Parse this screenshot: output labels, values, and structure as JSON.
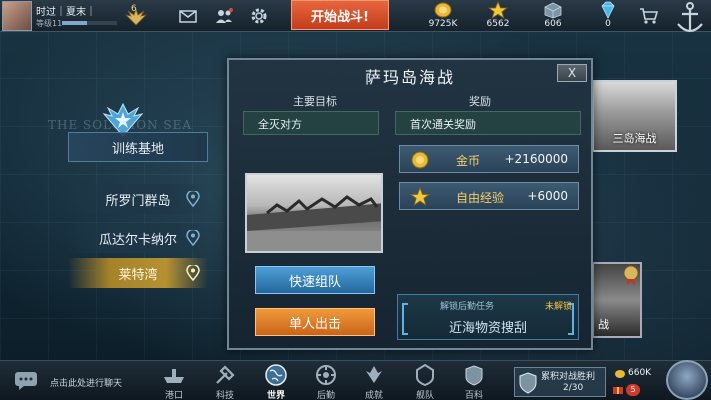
{
  "player": {
    "name": "时过｜夏末｜",
    "level_label": "等级11",
    "rank": "6",
    "xp_progress": 0.45
  },
  "top_actions": {
    "start_battle": "开始战斗!"
  },
  "resources": [
    {
      "icon": "gold-coin-icon",
      "value": "9725K"
    },
    {
      "icon": "star-exp-icon",
      "value": "6562"
    },
    {
      "icon": "supply-crate-icon",
      "value": "606"
    },
    {
      "icon": "diamond-icon",
      "value": "0"
    }
  ],
  "map": {
    "sea_label": "THE SOLOMON SEA"
  },
  "left_menu": {
    "base": "训练基地",
    "locations": [
      {
        "label": "所罗门群岛",
        "selected": false
      },
      {
        "label": "瓜达尔卡纳尔",
        "selected": false
      },
      {
        "label": "莱特湾",
        "selected": true
      }
    ]
  },
  "side_previews": {
    "preview_a_caption": "三岛海战",
    "preview_b_caption": "战"
  },
  "dialog": {
    "title": "萨玛岛海战",
    "close_label": "X",
    "objective_header": "主要目标",
    "reward_header": "奖励",
    "objective": "全灭对方",
    "first_clear_label": "首次通关奖励",
    "rewards": [
      {
        "icon": "gold-coin-icon",
        "name": "金币",
        "amount": "+2160000"
      },
      {
        "icon": "star-exp-icon",
        "name": "自由经验",
        "amount": "+6000"
      }
    ],
    "quick_team_label": "快速组队",
    "solo_label": "单人出击",
    "mission": {
      "label": "解锁后勤任务",
      "status": "未解锁",
      "name": "近海物资搜刮"
    }
  },
  "bottom_bar": {
    "chat_prompt": "点击此处进行聊天",
    "nav": [
      {
        "label": "港口",
        "icon": "port-icon",
        "active": false
      },
      {
        "label": "科技",
        "icon": "tech-icon",
        "active": false
      },
      {
        "label": "世界",
        "icon": "globe-icon",
        "active": true
      },
      {
        "label": "后勤",
        "icon": "logistics-icon",
        "active": false
      },
      {
        "label": "成就",
        "icon": "achievement-icon",
        "active": false
      },
      {
        "label": "舰队",
        "icon": "fleet-icon",
        "active": false
      },
      {
        "label": "百科",
        "icon": "encyclopedia-icon",
        "active": false
      }
    ],
    "pvp": {
      "label": "累积对战胜利",
      "progress": "2/30"
    },
    "pvp_reward": {
      "coins": "660K",
      "badge": "5"
    }
  },
  "colors": {
    "start_button": "#d64a24",
    "selected_location": "#c89a34",
    "reward_gold": "#f4cf6a"
  }
}
